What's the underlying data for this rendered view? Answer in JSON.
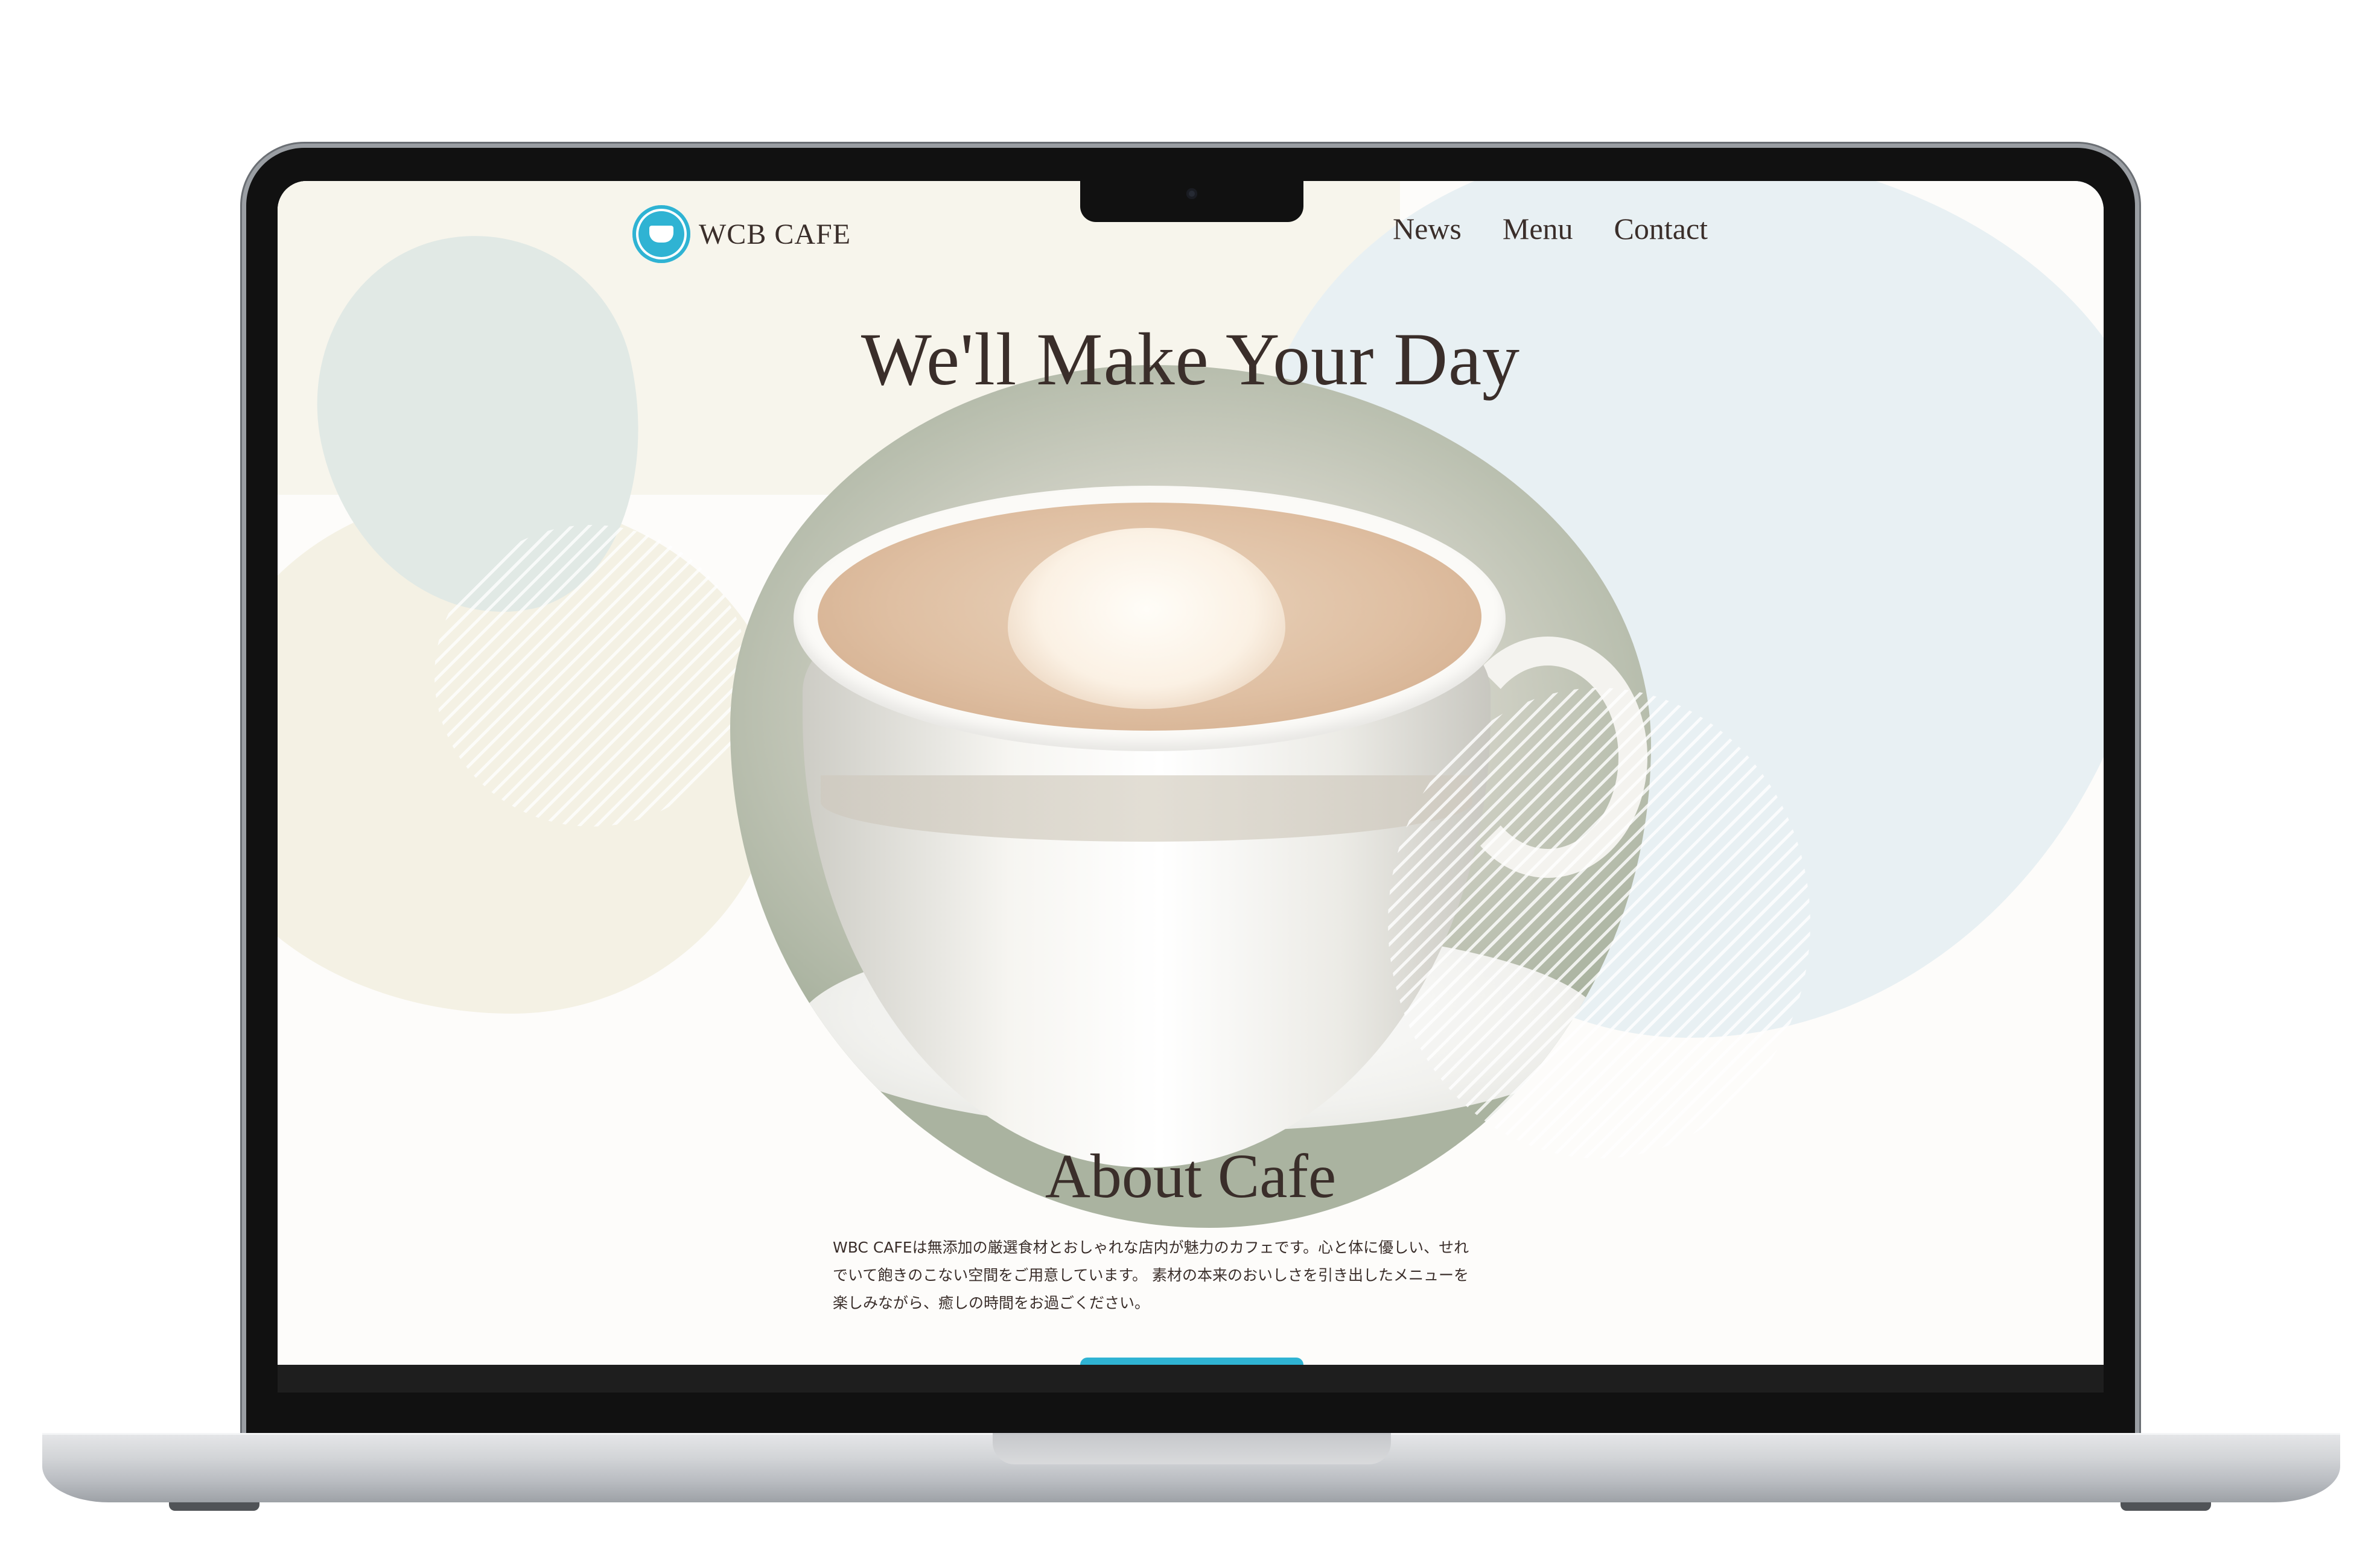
{
  "header": {
    "logo_text": "WCB CAFE",
    "logo_icon": "cup-badge-icon",
    "nav": [
      {
        "label": "News"
      },
      {
        "label": "Menu"
      },
      {
        "label": "Contact"
      }
    ]
  },
  "hero": {
    "title": "We'll Make Your Day"
  },
  "about": {
    "title": "About Cafe",
    "lines": [
      "WBC CAFEは無添加の厳選食材とおしゃれな店内が魅力のカフェです。心と体に優しい、せれ",
      "でいて飽きのこない空間をご用意しています。 素材の本来のおいしさを引き出したメニューを",
      "楽しみながら、癒しの時間をお過ごください。"
    ]
  },
  "colors": {
    "accent": "#2fb3d3",
    "text": "#3a2e2a",
    "cream": "#f7f5ec",
    "sky": "#e8f0f3"
  }
}
